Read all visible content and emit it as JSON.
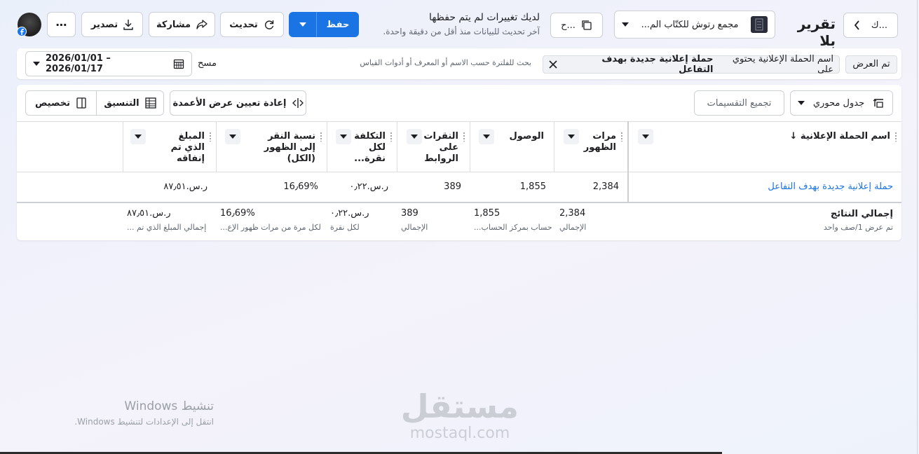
{
  "header": {
    "back_label": "ك...",
    "title": "تقرير بلا",
    "account_name": "مجمع رتوش للكتّاب الم...",
    "view_label": "ح...",
    "unsaved_title": "لديك تغييرات لم يتم حفظها",
    "unsaved_sub": "آخر تحديث للبيانات منذ أقل من دقيقة واحدة.",
    "save_label": "حفظ",
    "refresh_label": "تحديث",
    "share_label": "مشاركة",
    "export_label": "تصدير",
    "more_label": "⋯"
  },
  "filters": {
    "shown_label": "تم العرض",
    "chip_prefix": "اسم الحملة الإعلانية يحتوي على",
    "chip_value": "حملة إعلانية جديدة بهدف التفاعل",
    "search_placeholder": "بحث للفلترة حسب الاسم أو المعرف أو أدوات القياس",
    "clear_label": "مسح",
    "date_range": "2026/01/01 – 2026/01/17"
  },
  "toolbar": {
    "pivot_label": "جدول محوري",
    "group_label": "تجميع التقسيمات",
    "reset_label": "إعادة تعيين عرض الأعمدة",
    "format_label": "التنسيق",
    "customize_label": "تخصيص"
  },
  "table": {
    "columns": [
      {
        "label": "اسم الحملة الإعلانية ↓"
      },
      {
        "label": "مرات الظهور"
      },
      {
        "label": "الوصول"
      },
      {
        "label": "النقرات على الروابط"
      },
      {
        "label": "التكلفة لكل نقرة..."
      },
      {
        "label": "نسبة النقر إلى الظهور (الكل)"
      },
      {
        "label": "المبلغ الذي تم إنفاقه"
      }
    ],
    "row": {
      "name": "حملة إعلانية جديدة بهدف التفاعل",
      "impressions": "2,384",
      "reach": "1,855",
      "clicks": "389",
      "cpc": "ر.س.٠٫٢٢",
      "ctr": "16٫69%",
      "spent": "ر.س.٨٧٫٥١"
    },
    "totals": {
      "title": "إجمالي النتائج",
      "subtitle": "تم عرض 1/صف واحد",
      "impressions": "2,384",
      "impressions_sub": "الإجمالي",
      "reach": "1,855",
      "reach_sub": "حساب بمركز الحساب...",
      "clicks": "389",
      "clicks_sub": "الإجمالي",
      "cpc": "ر.س.٠٫٢٢",
      "cpc_sub": "لكل نقرة",
      "ctr": "16٫69%",
      "ctr_sub": "لكل مرة من مرات ظهور الإع...",
      "spent": "ر.س.٨٧٫٥١",
      "spent_sub": "إجمالي المبلغ الذي تم ..."
    }
  },
  "watermark": {
    "win_title": "تنشيط Windows",
    "win_sub": "انتقل إلى الإعدادات لتنشيط Windows.",
    "brand_ar": "مستقل",
    "brand_en": "mostaql.com"
  },
  "colors": {
    "accent": "#1b74e4",
    "link": "#1b74e4"
  }
}
